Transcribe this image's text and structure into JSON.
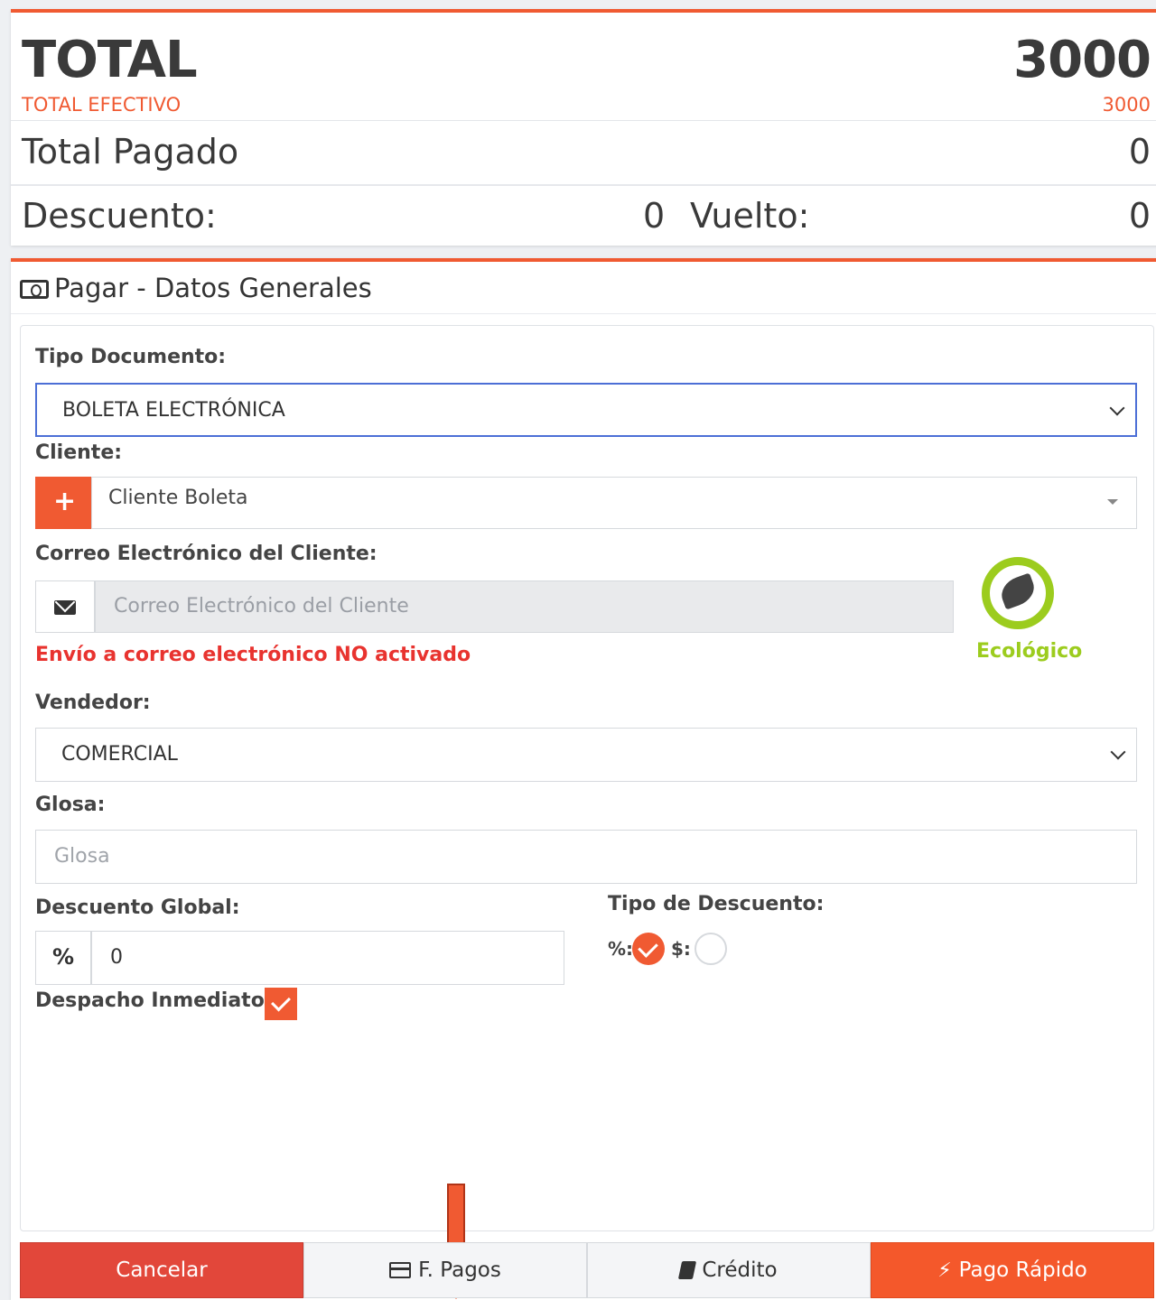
{
  "summary": {
    "total_label": "TOTAL",
    "total_value": "3000",
    "efectivo_label": "TOTAL EFECTIVO",
    "efectivo_value": "3000",
    "pagado_label": "Total Pagado",
    "pagado_value": "0",
    "descuento_label": "Descuento:",
    "descuento_value": "0",
    "vuelto_label": "Vuelto:",
    "vuelto_value": "0"
  },
  "panel": {
    "title": "Pagar - Datos Generales",
    "icon": "money-icon"
  },
  "form": {
    "tipo_documento_label": "Tipo Documento:",
    "tipo_documento_value": "BOLETA ELECTRÓNICA",
    "cliente_label": "Cliente:",
    "cliente_add_symbol": "+",
    "cliente_value": "Cliente Boleta",
    "correo_label": "Correo Electrónico del Cliente:",
    "correo_placeholder": "Correo Electrónico del Cliente",
    "correo_warning": "Envío a correo electrónico NO activado",
    "eco_label": "Ecológico",
    "vendedor_label": "Vendedor:",
    "vendedor_value": "COMERCIAL",
    "glosa_label": "Glosa:",
    "glosa_placeholder": "Glosa",
    "descuento_global_label": "Descuento Global:",
    "descuento_global_addon": "%",
    "descuento_global_value": "0",
    "tipo_descuento_label": "Tipo de Descuento:",
    "tipo_descuento_pct_label": "%:",
    "tipo_descuento_usd_label": "$:",
    "tipo_descuento_selected": "%",
    "despacho_label": "Despacho Inmediato",
    "despacho_checked": true
  },
  "buttons": {
    "cancel": "Cancelar",
    "fpagos": "F. Pagos",
    "credito": "Crédito",
    "rapido": "Pago Rápido"
  },
  "colors": {
    "accent": "#f05a32",
    "danger": "#e2473a",
    "eco_green": "#9ccc1e",
    "warning_text": "#e8332f",
    "focus_border": "#4c6fd6"
  }
}
